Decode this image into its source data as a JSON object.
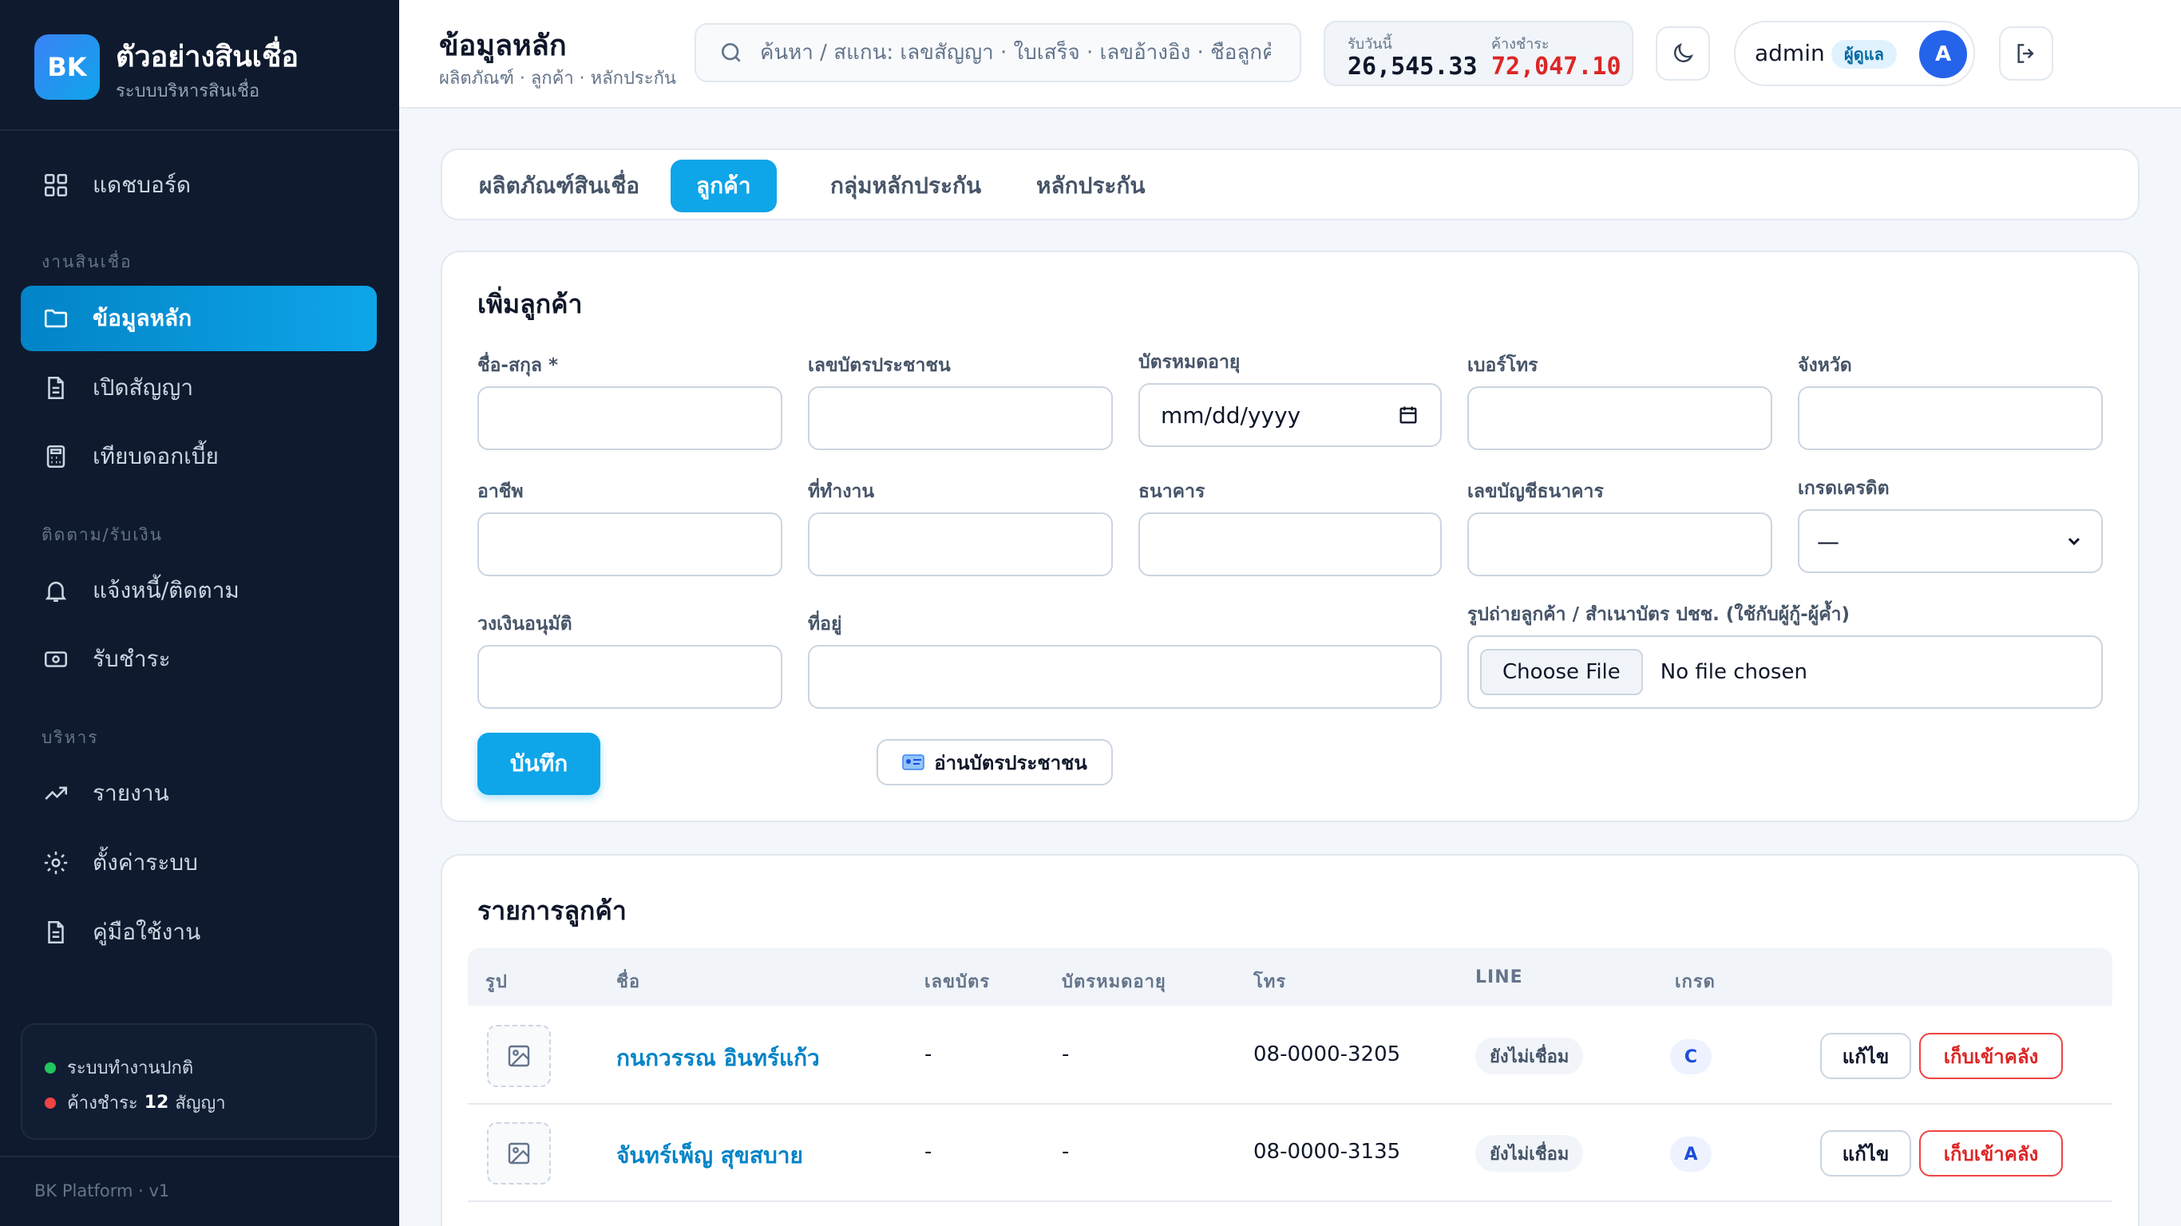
{
  "brand": {
    "logo": "BK",
    "title": "ตัวอย่างสินเชื่อ",
    "subtitle": "ระบบบริหารสินเชื่อ"
  },
  "sidebar": {
    "items": [
      {
        "label": "แดชบอร์ด",
        "icon": "grid-icon"
      },
      {
        "label": "ข้อมูลหลัก",
        "icon": "folder-icon",
        "active": true
      },
      {
        "label": "เปิดสัญญา",
        "icon": "document-icon"
      },
      {
        "label": "เทียบดอกเบี้ย",
        "icon": "calculator-icon"
      },
      {
        "label": "แจ้งหนี้/ติดตาม",
        "icon": "bell-icon"
      },
      {
        "label": "รับชำระ",
        "icon": "cash-icon"
      },
      {
        "label": "รายงาน",
        "icon": "trending-up-icon"
      },
      {
        "label": "ตั้งค่าระบบ",
        "icon": "gear-icon"
      },
      {
        "label": "คู่มือใช้งาน",
        "icon": "document-icon"
      }
    ],
    "sections": [
      "งานสินเชื่อ",
      "ติดตาม/รับเงิน",
      "บริหาร"
    ],
    "status": {
      "system_ok": "ระบบทำงานปกติ",
      "overdue_prefix": "ค้างชำระ",
      "overdue_count": "12",
      "overdue_suffix": "สัญญา"
    },
    "footer": "BK Platform · v1"
  },
  "header": {
    "title": "ข้อมูลหลัก",
    "breadcrumb": "ผลิตภัณฑ์ · ลูกค้า · หลักประกัน",
    "search_placeholder": "ค้นหา / สแกน: เลขสัญญา · ใบเสร็จ · เลขอ้างอิง · ชื่อลูกค้า",
    "received_today_label": "รับวันนี้",
    "received_today_value": "26,545.33",
    "overdue_label": "ค้างชำระ",
    "overdue_value": "72,047.10",
    "user_name": "admin",
    "user_role": "ผู้ดูแล",
    "avatar_initial": "A"
  },
  "tabs": [
    {
      "label": "ผลิตภัณฑ์สินเชื่อ"
    },
    {
      "label": "ลูกค้า",
      "active": true
    },
    {
      "label": "กลุ่มหลักประกัน"
    },
    {
      "label": "หลักประกัน"
    }
  ],
  "form": {
    "title": "เพิ่มลูกค้า",
    "fields": {
      "full_name": "ชื่อ-สกุล *",
      "id_number": "เลขบัตรประชาชน",
      "card_expiry": "บัตรหมดอายุ",
      "phone": "เบอร์โทร",
      "province": "จังหวัด",
      "occupation": "อาชีพ",
      "workplace": "ที่ทำงาน",
      "bank": "ธนาคาร",
      "bank_account": "เลขบัญชีธนาคาร",
      "credit_grade": "เกรดเครดิต",
      "approved_limit": "วงเงินอนุมัติ",
      "address": "ที่อยู่",
      "photo": "รูปถ่ายลูกค้า / สำเนาบัตร ปชช. (ใช้กับผู้กู้-ผู้ค้ำ)"
    },
    "date_placeholder": "mm/dd/yyyy",
    "grade_selected": "—",
    "file_button": "Choose File",
    "file_status": "No file chosen",
    "save_button": "บันทึก",
    "read_id_button": "อ่านบัตรประชาชน"
  },
  "customer_list": {
    "title": "รายการลูกค้า",
    "columns": [
      "รูป",
      "ชื่อ",
      "เลขบัตร",
      "บัตรหมดอายุ",
      "โทร",
      "LINE",
      "เกรด"
    ],
    "rows": [
      {
        "name": "กนกวรรณ อินทร์แก้ว",
        "id_number": "-",
        "card_expiry": "-",
        "phone": "08-0000-3205",
        "line": "ยังไม่เชื่อม",
        "grade": "C"
      },
      {
        "name": "จันทร์เพ็ญ สุขสบาย",
        "id_number": "-",
        "card_expiry": "-",
        "phone": "08-0000-3135",
        "line": "ยังไม่เชื่อม",
        "grade": "A"
      }
    ],
    "edit_label": "แก้ไข",
    "archive_label": "เก็บเข้าคลัง"
  },
  "colors": {
    "accent": "#0ea5e9",
    "sidebar_bg": "#0f1a2e",
    "danger": "#dc2626",
    "ok": "#22c55e"
  }
}
